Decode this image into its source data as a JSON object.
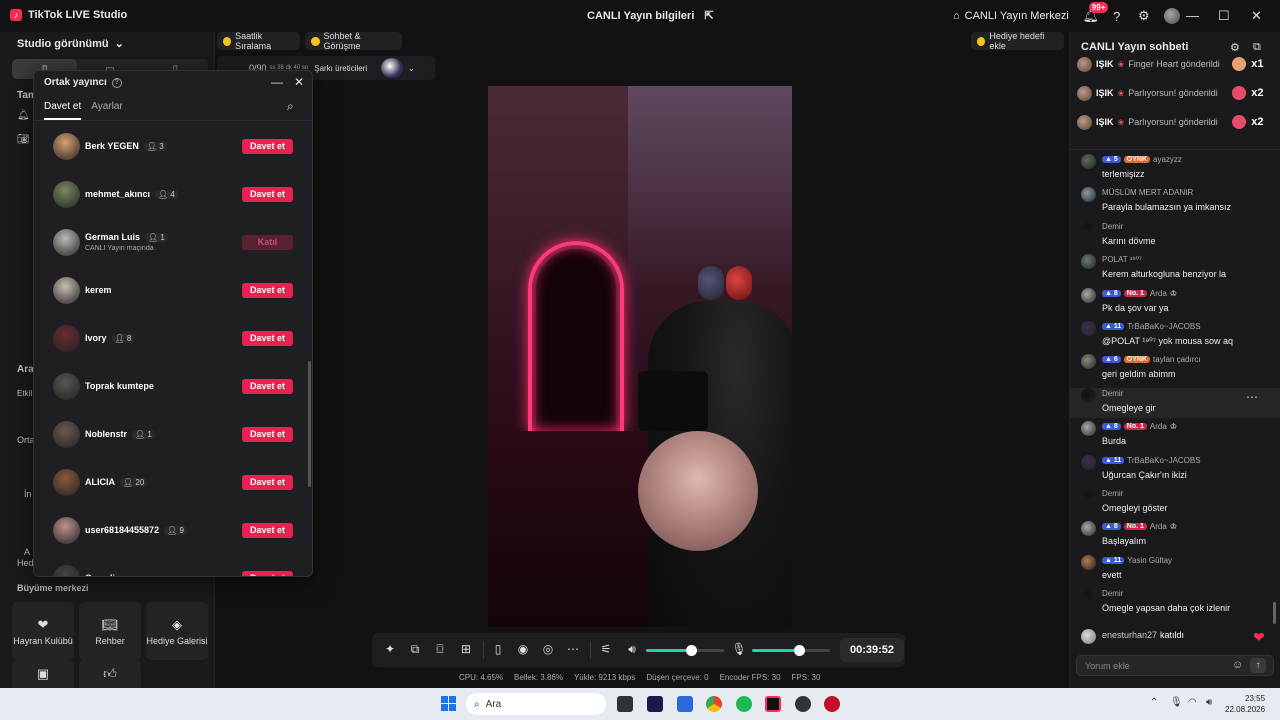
{
  "app": {
    "title": "TikTok LIVE Studio"
  },
  "header": {
    "center_title": "CANLI Yayın bilgileri",
    "live_center": "CANLI Yayın Merkezi",
    "notif_badge": "99+"
  },
  "left": {
    "studio_view": "Studio görünümü",
    "growth_title": "Büyüme merkezi",
    "side_labels": [
      "Tam",
      "Ara",
      "Etkil",
      "Orta",
      "İn",
      "A",
      "Hed"
    ],
    "tiles": [
      {
        "label": "Hayran Kulübü",
        "icon": "heart-shield-icon"
      },
      {
        "label": "Rehber",
        "icon": "book-icon"
      },
      {
        "label": "Hediye Galerisi",
        "icon": "gift-icon"
      }
    ]
  },
  "toolbar": {
    "hourly_rank": "Saatlik Sıralama",
    "chat_talk": "Sohbet & Görüşme",
    "gift_goal": "Hediye hedefi ekle",
    "song_counter": "0/90",
    "song_time": "ss 38 dk 40 sn",
    "song_creators": "Şarkı üreticileri"
  },
  "modal": {
    "title": "Ortak yayıncı",
    "tabs": [
      "Davet et",
      "Ayarlar"
    ],
    "invite_label": "Davet et",
    "joined_label": "Katıl",
    "users": [
      {
        "name": "Berk YEGEN",
        "count": "3",
        "sub": "",
        "joined": false,
        "color": "#d8a070"
      },
      {
        "name": "mehmet_akıncı",
        "count": "4",
        "sub": "",
        "joined": false,
        "color": "#7a8a60"
      },
      {
        "name": "German Luis",
        "count": "1",
        "sub": "CANLI Yayın maçında",
        "joined": true,
        "color": "#bbbbbb"
      },
      {
        "name": "kerem",
        "count": "",
        "sub": "",
        "joined": false,
        "color": "#c8c0b0"
      },
      {
        "name": "Ivory",
        "count": "8",
        "sub": "",
        "joined": false,
        "color": "#6a2a30"
      },
      {
        "name": "Toprak kumtepe",
        "count": "",
        "sub": "",
        "joined": false,
        "color": "#555555"
      },
      {
        "name": "Noblenstr",
        "count": "1",
        "sub": "",
        "joined": false,
        "color": "#6a5a50"
      },
      {
        "name": "ALICIA",
        "count": "20",
        "sub": "",
        "joined": false,
        "color": "#8a5a3a"
      },
      {
        "name": "user68184455872",
        "count": "9",
        "sub": "",
        "joined": false,
        "color": "#c09090"
      },
      {
        "name": "Cumali",
        "count": "",
        "sub": "",
        "joined": false,
        "color": "#444444"
      }
    ]
  },
  "controls": {
    "timer": "00:39:52",
    "volume": 0.58,
    "mic": 0.6
  },
  "stats": [
    "CPU: 4.65%",
    "Bellek: 3.86%",
    "Yükle: 9213 kbps",
    "Düşen çerçeve: 0",
    "Encoder FPS: 30",
    "FPS: 30"
  ],
  "chat": {
    "title": "CANLI Yayın sohbeti",
    "gifts": [
      {
        "name": "IŞIK",
        "text": "Finger Heart gönderildi",
        "mult": "x1",
        "color": "#e8a070"
      },
      {
        "name": "IŞIK",
        "text": "Parlıyorsun! gönderildi",
        "mult": "x2",
        "color": "#e84a6a"
      },
      {
        "name": "IŞIK",
        "text": "Parlıyorsun! gönderildi",
        "mult": "x2",
        "color": "#e84a6a"
      }
    ],
    "messages": [
      {
        "user": "ayazyzz",
        "level": "5",
        "tag": "OYNK",
        "tag_type": "b",
        "crown": false,
        "text": "terlemişizz",
        "color": "#5a6a5a"
      },
      {
        "user": "MÜSLÜM MERT ADANIR",
        "level": "",
        "tag": "",
        "tag_type": "",
        "crown": false,
        "text": "Parayla bulamazsın ya imkansız",
        "color": "#889aa8"
      },
      {
        "user": "Demir",
        "level": "",
        "tag": "",
        "tag_type": "",
        "crown": false,
        "text": "Karını dövme",
        "color": "#111111"
      },
      {
        "user": "POLAT ¹⁹⁰⁷",
        "level": "",
        "tag": "",
        "tag_type": "",
        "crown": false,
        "text": "Kerem alturkogluna benziyor la",
        "color": "#6a7a70"
      },
      {
        "user": "Arda",
        "level": "8",
        "tag": "No. 1",
        "tag_type": "r",
        "crown": true,
        "text": "Pk da şov var ya",
        "color": "#aaaaaa"
      },
      {
        "user": "TrBaBaKo~JACOBS",
        "level": "11",
        "tag": "",
        "tag_type": "",
        "crown": false,
        "text": "@POLAT ¹⁹⁰⁷ yok mousa sow aq",
        "color": "#3a3050"
      },
      {
        "user": "taylan çadırcı",
        "level": "6",
        "tag": "OYNK",
        "tag_type": "b",
        "crown": false,
        "text": "geri geldim abimm",
        "color": "#8a8a7a"
      },
      {
        "user": "Demir",
        "level": "",
        "tag": "",
        "tag_type": "",
        "crown": false,
        "text": "Omegleye gir",
        "color": "#111111"
      },
      {
        "user": "Arda",
        "level": "8",
        "tag": "No. 1",
        "tag_type": "r",
        "crown": true,
        "text": "Burda",
        "color": "#aaaaaa"
      },
      {
        "user": "TrBaBaKo~JACOBS",
        "level": "11",
        "tag": "",
        "tag_type": "",
        "crown": false,
        "text": "Uğurcan Çakır'ın ikizi",
        "color": "#3a3050"
      },
      {
        "user": "Demir",
        "level": "",
        "tag": "",
        "tag_type": "",
        "crown": false,
        "text": "Omegleyi göster",
        "color": "#111111"
      },
      {
        "user": "Arda",
        "level": "8",
        "tag": "No. 1",
        "tag_type": "r",
        "crown": true,
        "text": "Başlayalım",
        "color": "#aaaaaa"
      },
      {
        "user": "Yasin Gültay",
        "level": "11",
        "tag": "",
        "tag_type": "",
        "crown": false,
        "text": "evett",
        "color": "#b07a50"
      },
      {
        "user": "Demir",
        "level": "",
        "tag": "",
        "tag_type": "",
        "crown": false,
        "text": "Omegle yapsan daha çok izlenir",
        "color": "#111111"
      }
    ],
    "joined_user": "enesturhan27",
    "joined_text": "katıldı",
    "input_placeholder": "Yorum ekle"
  },
  "taskbar": {
    "search": "Ara",
    "time": "23:55",
    "date": "22.08.2026"
  }
}
